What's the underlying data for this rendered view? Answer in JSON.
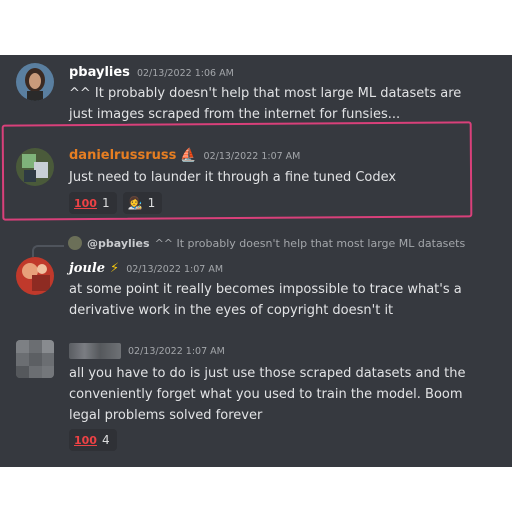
{
  "messages": [
    {
      "username": "pbaylies",
      "timestamp": "02/13/2022 1:06 AM",
      "lines": [
        "^^ It probably doesn't help that most large ML datasets are",
        "just images scraped from the internet for funsies..."
      ]
    },
    {
      "username": "danielrussruss",
      "username_badge": "⛵",
      "timestamp": "02/13/2022 1:07 AM",
      "lines": [
        "Just need to launder it through a fine tuned Codex"
      ],
      "reactions": [
        {
          "emoji": "100",
          "count": "1"
        },
        {
          "emoji": "👩‍🎨",
          "count": "1"
        }
      ]
    },
    {
      "reply_to": {
        "mention": "@pbaylies",
        "snippet": "^^ It probably doesn't help that most large ML datasets"
      },
      "username": "joule",
      "username_badge": "⚡",
      "timestamp": "02/13/2022 1:07 AM",
      "lines": [
        "at some point it really becomes impossible to trace what's a",
        "derivative work in the eyes of copyright doesn't it"
      ]
    },
    {
      "username": "",
      "timestamp": "02/13/2022 1:07 AM",
      "lines": [
        "all you have to do is just use those scraped datasets and the",
        "conveniently forget what you used to train the model. Boom",
        "legal problems solved forever"
      ],
      "reactions": [
        {
          "emoji": "100",
          "count": "4"
        }
      ]
    }
  ],
  "colors": {
    "background": "#36393f",
    "highlight_annotation": "#d9407a",
    "username_orange": "#e67e22",
    "hundred_emoji_red": "#ed4245"
  }
}
